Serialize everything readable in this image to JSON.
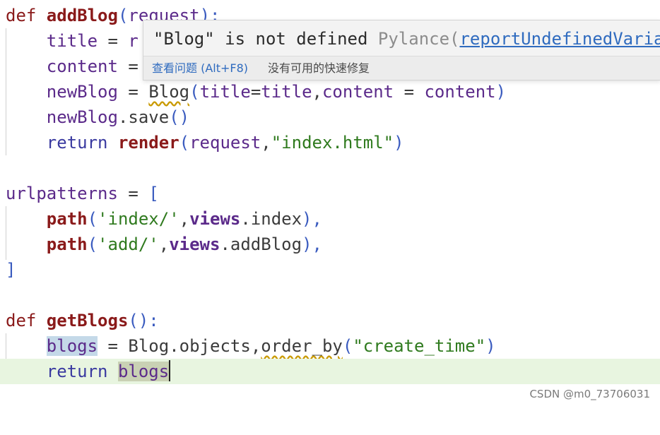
{
  "code": {
    "l1": {
      "def": "def ",
      "name": "addBlog",
      "open": "(",
      "arg": "request",
      "close": "):"
    },
    "l2": {
      "var": "title",
      "op": " = ",
      "frag": "r"
    },
    "l3": {
      "var": "content",
      "op": " = "
    },
    "l4": {
      "var": "newBlog",
      "op": " = ",
      "cls": "Blog",
      "open": "(",
      "a1": "title",
      "eq1": "=",
      "a2": "title",
      "comma": ",",
      "a3": "content",
      "eq2": " = ",
      "a4": "content",
      "close": ")"
    },
    "l5": {
      "var": "newBlog",
      "dot": ".",
      "method": "save",
      "parens": "()"
    },
    "l6": {
      "ret": "return ",
      "fn": "render",
      "open": "(",
      "arg": "request",
      "comma": ",",
      "str": "\"index.html\"",
      "close": ")"
    },
    "l7": {
      "var": "urlpatterns",
      "op": " = ",
      "bracket": "["
    },
    "l8": {
      "fn": "path",
      "open": "(",
      "str": "'index/'",
      "comma": ",",
      "mod": "views",
      "dot": ".",
      "attr": "index",
      "close": "),"
    },
    "l9": {
      "fn": "path",
      "open": "(",
      "str": "'add/'",
      "comma": ",",
      "mod": "views",
      "dot": ".",
      "attr": "addBlog",
      "close": "),"
    },
    "l10": {
      "bracket": "]"
    },
    "l11": {
      "def": "def ",
      "name": "getBlogs",
      "parens": "():"
    },
    "l12": {
      "var": "blogs",
      "op": " = ",
      "cls": "Blog",
      "dot": ".",
      "attr": "objects",
      "comma": ",",
      "method": "order_by",
      "open": "(",
      "str": "\"create_time\"",
      "close": ")"
    },
    "l13": {
      "ret": "return ",
      "var": "blogs"
    }
  },
  "hover": {
    "message": "\"Blog\" is not defined",
    "source": "Pylance(",
    "rule": "reportUndefinedVariable",
    "view_problem": "查看问题 (Alt+F8)",
    "no_fix": "没有可用的快速修复"
  },
  "watermark": "CSDN @m0_73706031"
}
